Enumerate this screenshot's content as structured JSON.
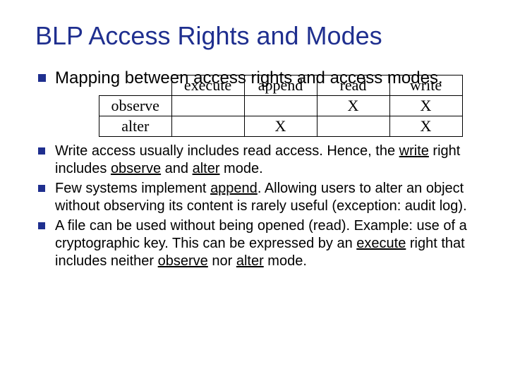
{
  "title": "BLP Access Rights and Modes",
  "lead": "Mapping between access rights and access modes.",
  "table": {
    "cols": [
      "execute",
      "append",
      "read",
      "write"
    ],
    "rows": [
      {
        "label": "observe",
        "cells": [
          "",
          "",
          "X",
          "X"
        ]
      },
      {
        "label": "alter",
        "cells": [
          "",
          "X",
          "",
          "X"
        ]
      }
    ]
  },
  "b1": {
    "a": "Write access usually includes read access. Hence, the ",
    "w": "write",
    "b": " right includes ",
    "o": "observe",
    "c": " and ",
    "al": "alter",
    "d": " mode."
  },
  "b2": {
    "a": "Few systems implement ",
    "ap": "append",
    "b": ". Allowing users to alter an object without observing its content is rarely useful (exception: audit log)."
  },
  "b3": {
    "a": "A file can be used without being opened (read). Example: use of a cryptographic key. This can be expressed by an ",
    "ex": "execute",
    "b": " right that includes neither ",
    "o": "observe",
    "c": " nor ",
    "al": "alter",
    "d": " mode."
  }
}
